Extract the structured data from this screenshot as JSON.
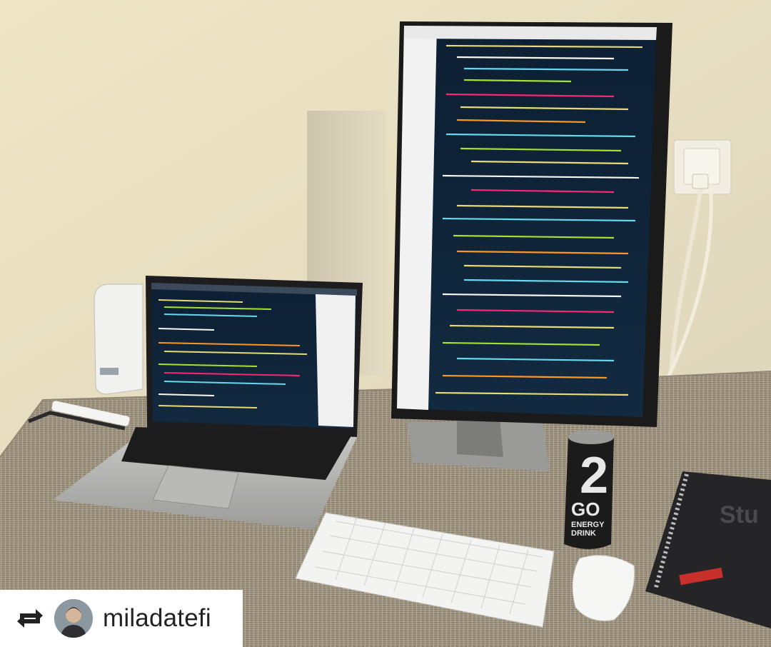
{
  "repost": {
    "icon": "repost-icon",
    "username": "miladatefi"
  },
  "scene": {
    "can_brand_number": "2",
    "can_brand_name": "GO",
    "can_tagline_1": "ENERGY",
    "can_tagline_2": "DRINK",
    "notebook_title": "Stu"
  }
}
